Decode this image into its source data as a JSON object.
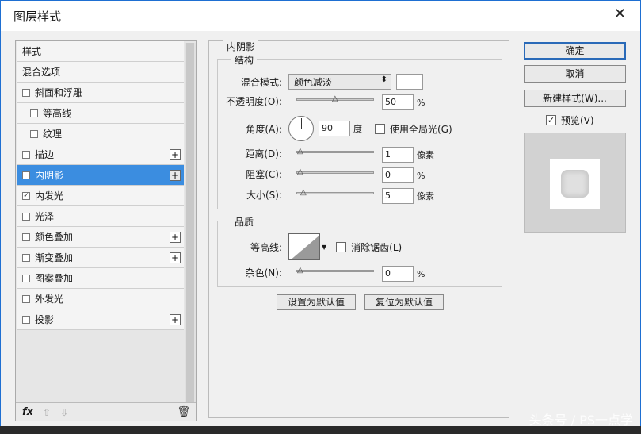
{
  "window": {
    "title": "图层样式"
  },
  "left_panel": {
    "items": [
      {
        "label": "样式",
        "checkbox": false,
        "plus": false
      },
      {
        "label": "混合选项",
        "checkbox": false,
        "plus": false
      },
      {
        "label": "斜面和浮雕",
        "checkbox": true,
        "checked": false,
        "plus": false
      },
      {
        "label": "等高线",
        "checkbox": true,
        "checked": false,
        "plus": false,
        "sub": true
      },
      {
        "label": "纹理",
        "checkbox": true,
        "checked": false,
        "plus": false,
        "sub": true
      },
      {
        "label": "描边",
        "checkbox": true,
        "checked": false,
        "plus": true
      },
      {
        "label": "内阴影",
        "checkbox": true,
        "checked": true,
        "plus": true,
        "selected": true
      },
      {
        "label": "内发光",
        "checkbox": true,
        "checked": true,
        "plus": false
      },
      {
        "label": "光泽",
        "checkbox": true,
        "checked": false,
        "plus": false
      },
      {
        "label": "颜色叠加",
        "checkbox": true,
        "checked": false,
        "plus": true
      },
      {
        "label": "渐变叠加",
        "checkbox": true,
        "checked": false,
        "plus": true
      },
      {
        "label": "图案叠加",
        "checkbox": true,
        "checked": false,
        "plus": false
      },
      {
        "label": "外发光",
        "checkbox": true,
        "checked": false,
        "plus": false
      },
      {
        "label": "投影",
        "checkbox": true,
        "checked": false,
        "plus": true
      }
    ],
    "footer": {
      "fx": "fx",
      "up": "⇧",
      "down": "⇩",
      "trash": "🗑"
    }
  },
  "inner_shadow": {
    "section_title": "内阴影",
    "structure": {
      "title": "结构",
      "blend_mode_label": "混合模式:",
      "blend_mode_value": "颜色减淡",
      "color_hex": "#ffffff",
      "opacity_label": "不透明度(O):",
      "opacity_value": "50",
      "opacity_unit": "%",
      "angle_label": "角度(A):",
      "angle_value": "90",
      "angle_unit": "度",
      "global_light_label": "使用全局光(G)",
      "distance_label": "距离(D):",
      "distance_value": "1",
      "distance_unit": "像素",
      "choke_label": "阻塞(C):",
      "choke_value": "0",
      "choke_unit": "%",
      "size_label": "大小(S):",
      "size_value": "5",
      "size_unit": "像素"
    },
    "quality": {
      "title": "品质",
      "contour_label": "等高线:",
      "antialias_label": "消除锯齿(L)",
      "noise_label": "杂色(N):",
      "noise_value": "0",
      "noise_unit": "%"
    },
    "make_default": "设置为默认值",
    "reset_default": "复位为默认值"
  },
  "right_panel": {
    "ok": "确定",
    "cancel": "取消",
    "new_style": "新建样式(W)...",
    "preview_label": "预览(V)",
    "preview_checked": true
  },
  "watermark": "头条号 / PS一点学"
}
